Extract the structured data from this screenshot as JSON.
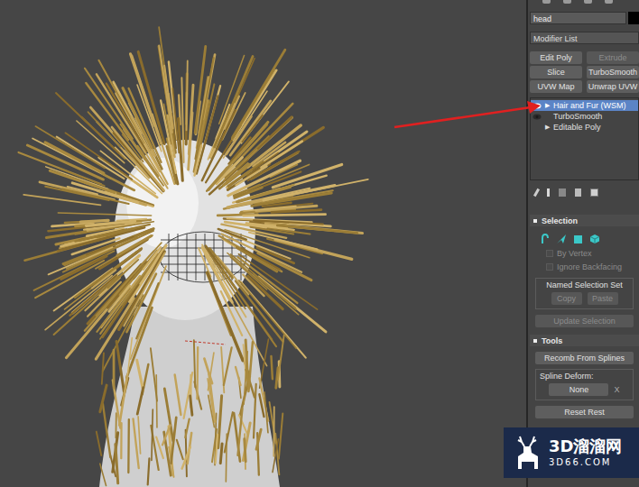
{
  "object_name": "head",
  "modifier_list": "Modifier List",
  "modifier_buttons": [
    {
      "label": "Edit Poly",
      "disabled": false
    },
    {
      "label": "Extrude",
      "disabled": true
    },
    {
      "label": "Slice",
      "disabled": false
    },
    {
      "label": "TurboSmooth",
      "disabled": false
    },
    {
      "label": "UVW Map",
      "disabled": false
    },
    {
      "label": "Unwrap UVW",
      "disabled": false
    }
  ],
  "stack": [
    {
      "label": "Hair and Fur (WSM)",
      "selected": true,
      "expander": "▶",
      "eye": "on"
    },
    {
      "label": "TurboSmooth",
      "selected": false,
      "expander": "",
      "eye": "dim"
    },
    {
      "label": "Editable Poly",
      "selected": false,
      "expander": "▶",
      "eye": "none"
    }
  ],
  "selection_rollout": {
    "title": "Selection",
    "expanded": true,
    "checkboxes": [
      {
        "label": "By Vertex",
        "checked": false,
        "disabled": true
      },
      {
        "label": "Ignore Backfacing",
        "checked": false,
        "disabled": true
      }
    ],
    "named_selection_set": {
      "title": "Named Selection Set",
      "buttons": [
        {
          "label": "Copy",
          "disabled": true
        },
        {
          "label": "Paste",
          "disabled": true
        }
      ]
    },
    "update_button": {
      "label": "Update Selection",
      "disabled": true
    }
  },
  "tools_rollout": {
    "title": "Tools",
    "expanded": true,
    "recomb_button": "Recomb From Splines",
    "spline_deform": {
      "title": "Spline Deform:",
      "button": "None",
      "clear": "X"
    },
    "reset_button": "Reset Rest"
  },
  "watermark": {
    "title": "3D溜溜网",
    "url": "3D66.COM"
  }
}
